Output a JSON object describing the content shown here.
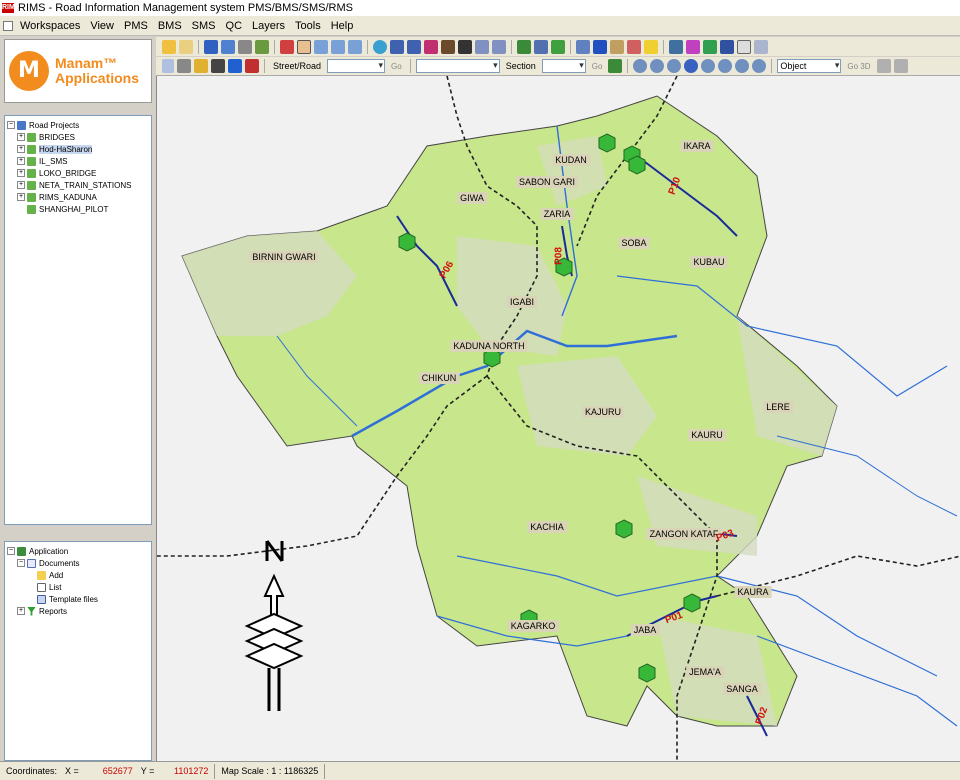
{
  "window": {
    "title": "RIMS - Road Information Management system PMS/BMS/SMS/RMS",
    "app_icon": "RIMS"
  },
  "menu": [
    "Workspaces",
    "View",
    "PMS",
    "BMS",
    "SMS",
    "QC",
    "Layers",
    "Tools",
    "Help"
  ],
  "logo": {
    "mark": "M",
    "line1": "Manam™",
    "line2": "Applications"
  },
  "project_tree": {
    "root": "Road Projects",
    "items": [
      "BRIDGES",
      "Hod-HaSharon",
      "IL_SMS",
      "LOKO_BRIDGE",
      "NETA_TRAIN_STATIONS",
      "RIMS_KADUNA",
      "SHANGHAI_PILOT"
    ],
    "selected": "Hod-HaSharon"
  },
  "app_tree": {
    "root": "Application",
    "documents": "Documents",
    "doc_children": [
      "Add",
      "List",
      "Template files"
    ],
    "reports": "Reports"
  },
  "toolbar2": {
    "street_label": "Street/Road",
    "go1": "Go",
    "section_label": "Section",
    "go2": "Go",
    "object_label": "Object",
    "go3d": "Go 3D"
  },
  "map": {
    "regions": [
      {
        "name": "GIWA"
      },
      {
        "name": "KUDAN"
      },
      {
        "name": "SABON GARI"
      },
      {
        "name": "IKARA"
      },
      {
        "name": "ZARIA"
      },
      {
        "name": "BIRNIN GWARI"
      },
      {
        "name": "SOBA"
      },
      {
        "name": "KUBAU"
      },
      {
        "name": "IGABI"
      },
      {
        "name": "KADUNA NORTH"
      },
      {
        "name": "CHIKUN"
      },
      {
        "name": "KAJURU"
      },
      {
        "name": "LERE"
      },
      {
        "name": "KAURU"
      },
      {
        "name": "KACHIA"
      },
      {
        "name": "ZANGON KATAF"
      },
      {
        "name": "KAURA"
      },
      {
        "name": "KAGARKO"
      },
      {
        "name": "JABA"
      },
      {
        "name": "JEMA'A"
      },
      {
        "name": "SANGA"
      }
    ],
    "roads": [
      "P10",
      "P06",
      "P08",
      "P03",
      "P01",
      "P02"
    ],
    "north_label": "N",
    "colors": {
      "region_fill": "#c8e68c",
      "region_alt": "#d4dcc0",
      "river": "#2f6fd8",
      "road": "#1a2a9a",
      "marker": "#38b838",
      "boundary": "#222222"
    }
  },
  "status": {
    "coords_label": "Coordinates:",
    "x_label": "X =",
    "x_value": "652677",
    "y_label": "Y =",
    "y_value": "1101272",
    "scale_label": "Map Scale : 1 : 1186325"
  }
}
